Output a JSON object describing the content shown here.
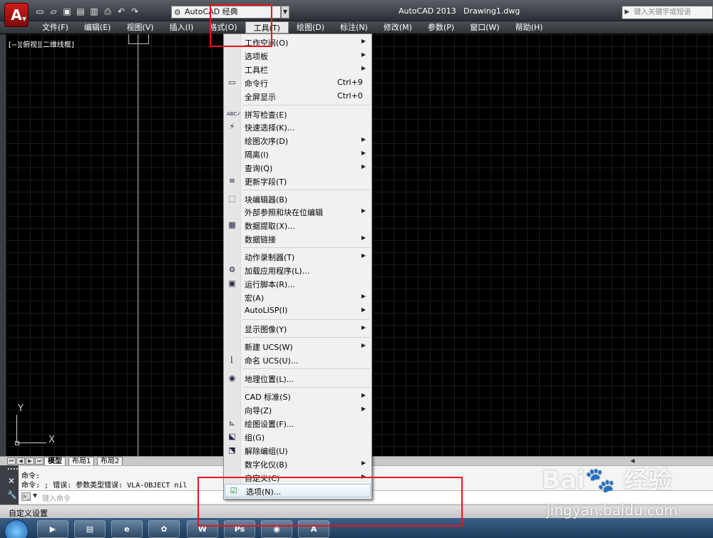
{
  "titlebar": {
    "logo": "A",
    "workspace": "AutoCAD 经典",
    "app_title": "AutoCAD 2013",
    "doc_title": "Drawing1.dwg",
    "search_placeholder": "键入关键字或短语"
  },
  "menubar": [
    {
      "label": "文件(F)"
    },
    {
      "label": "编辑(E)"
    },
    {
      "label": "视图(V)"
    },
    {
      "label": "插入(I)"
    },
    {
      "label": "格式(O)"
    },
    {
      "label": "工具(T)"
    },
    {
      "label": "绘图(D)"
    },
    {
      "label": "标注(N)"
    },
    {
      "label": "修改(M)"
    },
    {
      "label": "参数(P)"
    },
    {
      "label": "窗口(W)"
    },
    {
      "label": "帮助(H)"
    }
  ],
  "viewport_label": "[−][俯视][二维线框]",
  "ucs": {
    "x": "X",
    "y": "Y"
  },
  "tabs": {
    "model": "模型",
    "layout1": "布局1",
    "layout2": "布局2"
  },
  "command": {
    "line1": "命令:",
    "line2": "命令: ; 错误: 参数类型错误: VLA-OBJECT nil",
    "placeholder": "键入命令"
  },
  "status": "自定义设置",
  "tools_menu": {
    "items": [
      {
        "label": "工作空间(O)",
        "sub": true
      },
      {
        "label": "选项板",
        "sub": true
      },
      {
        "label": "工具栏",
        "sub": true
      },
      {
        "label": "命令行",
        "shortcut": "Ctrl+9",
        "icon": "command-line-icon"
      },
      {
        "label": "全屏显示",
        "shortcut": "Ctrl+0"
      },
      {
        "label": "拼写检查(E)",
        "icon": "spell-check-icon"
      },
      {
        "label": "快速选择(K)...",
        "icon": "quick-select-icon"
      },
      {
        "label": "绘图次序(D)",
        "sub": true
      },
      {
        "label": "隔离(I)",
        "sub": true
      },
      {
        "label": "查询(Q)",
        "sub": true
      },
      {
        "label": "更新字段(T)",
        "icon": "update-field-icon"
      },
      {
        "label": "块编辑器(B)",
        "icon": "block-editor-icon"
      },
      {
        "label": "外部参照和块在位编辑",
        "sub": true
      },
      {
        "label": "数据提取(X)...",
        "icon": "data-extraction-icon"
      },
      {
        "label": "数据链接",
        "sub": true
      },
      {
        "label": "动作录制器(T)",
        "sub": true
      },
      {
        "label": "加载应用程序(L)...",
        "icon": "load-application-icon"
      },
      {
        "label": "运行脚本(R)...",
        "icon": "run-script-icon"
      },
      {
        "label": "宏(A)",
        "sub": true
      },
      {
        "label": "AutoLISP(I)",
        "sub": true
      },
      {
        "label": "显示图像(Y)",
        "sub": true
      },
      {
        "label": "新建 UCS(W)",
        "sub": true
      },
      {
        "label": "命名 UCS(U)...",
        "icon": "named-ucs-icon"
      },
      {
        "label": "地理位置(L)...",
        "icon": "geographic-location-icon"
      },
      {
        "label": "CAD 标准(S)",
        "sub": true
      },
      {
        "label": "向导(Z)",
        "sub": true
      },
      {
        "label": "绘图设置(F)...",
        "icon": "drafting-settings-icon"
      },
      {
        "label": "组(G)",
        "icon": "group-icon"
      },
      {
        "label": "解除编组(U)",
        "icon": "ungroup-icon"
      },
      {
        "label": "数字化仪(B)",
        "sub": true
      },
      {
        "label": "自定义(C)",
        "sub": true
      },
      {
        "label": "选项(N)...",
        "icon": "options-icon"
      }
    ]
  },
  "colors": {
    "accent": "#e8141b",
    "menu_bg": "#f1f1f1",
    "canvas": "#000000"
  }
}
